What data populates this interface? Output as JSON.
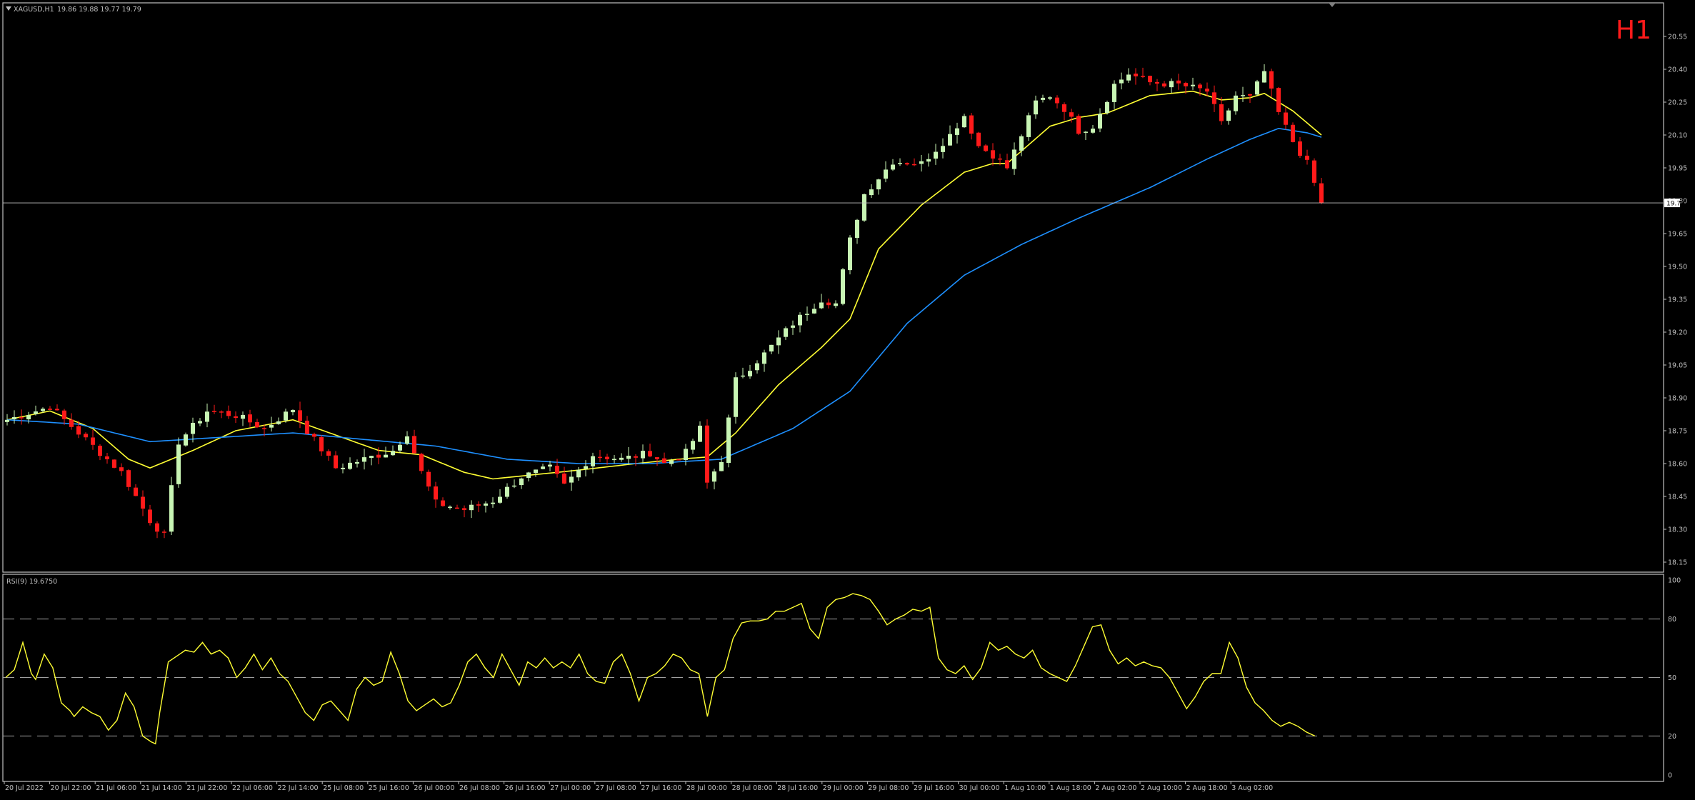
{
  "header": {
    "symbol_label": "XAGUSD,H1",
    "ohlc_label": "19.86 19.88 19.77 19.79",
    "timeframe_badge": "H1"
  },
  "indicator": {
    "label": "RSI(9) 19.6750"
  },
  "colors": {
    "background": "#000000",
    "grid_frame": "#c0c0c0",
    "axis_text": "#c0c0c0",
    "bull_candle": "#c8f5b4",
    "bear_candle": "#ff1a1a",
    "ma_fast": "#ffff33",
    "ma_slow": "#1e90ff",
    "rsi_line": "#ffff33",
    "rsi_level": "#a0a0a0",
    "badge": "#ff1a1a"
  },
  "chart_data": [
    {
      "type": "candlestick",
      "panel": "price",
      "symbol": "XAGUSD",
      "timeframe": "H1",
      "ylim": [
        18.15,
        20.55
      ],
      "y_ticks": [
        20.55,
        20.4,
        20.25,
        20.1,
        19.95,
        19.8,
        19.65,
        19.5,
        19.35,
        19.2,
        19.05,
        18.9,
        18.75,
        18.6,
        18.45,
        18.3,
        18.15
      ],
      "y_tick_labels": [
        "20.55",
        "20.40",
        "20.25",
        "20.10",
        "19.95",
        "19.80",
        "19.65",
        "19.50",
        "19.35",
        "19.20",
        "19.05",
        "18.90",
        "18.75",
        "18.60",
        "18.45",
        "18.30",
        "18.15"
      ],
      "current_price": 19.79,
      "current_price_label": "19.79",
      "x_labels": [
        "20 Jul 2022",
        "20 Jul 22:00",
        "21 Jul 06:00",
        "21 Jul 14:00",
        "21 Jul 22:00",
        "22 Jul 06:00",
        "22 Jul 14:00",
        "25 Jul 08:00",
        "25 Jul 16:00",
        "26 Jul 00:00",
        "26 Jul 08:00",
        "26 Jul 16:00",
        "27 Jul 00:00",
        "27 Jul 08:00",
        "27 Jul 16:00",
        "28 Jul 00:00",
        "28 Jul 08:00",
        "28 Jul 16:00",
        "29 Jul 00:00",
        "29 Jul 08:00",
        "29 Jul 16:00",
        "30 Jul 00:00",
        "1 Aug 10:00",
        "1 Aug 18:00",
        "2 Aug 02:00",
        "2 Aug 10:00",
        "2 Aug 18:00",
        "3 Aug 02:00"
      ],
      "close_anchors": [
        [
          0,
          18.8
        ],
        [
          6,
          18.86
        ],
        [
          10,
          18.74
        ],
        [
          16,
          18.56
        ],
        [
          20,
          18.34
        ],
        [
          22,
          18.27
        ],
        [
          24,
          18.7
        ],
        [
          28,
          18.84
        ],
        [
          32,
          18.82
        ],
        [
          36,
          18.76
        ],
        [
          40,
          18.85
        ],
        [
          42,
          18.75
        ],
        [
          46,
          18.58
        ],
        [
          50,
          18.62
        ],
        [
          54,
          18.66
        ],
        [
          56,
          18.74
        ],
        [
          58,
          18.56
        ],
        [
          60,
          18.42
        ],
        [
          64,
          18.39
        ],
        [
          68,
          18.43
        ],
        [
          72,
          18.54
        ],
        [
          76,
          18.58
        ],
        [
          78,
          18.5
        ],
        [
          82,
          18.64
        ],
        [
          86,
          18.62
        ],
        [
          90,
          18.65
        ],
        [
          92,
          18.6
        ],
        [
          95,
          18.65
        ],
        [
          97,
          18.76
        ],
        [
          98,
          18.51
        ],
        [
          100,
          18.62
        ],
        [
          102,
          18.98
        ],
        [
          106,
          19.1
        ],
        [
          110,
          19.24
        ],
        [
          114,
          19.35
        ],
        [
          116,
          19.33
        ],
        [
          118,
          19.62
        ],
        [
          120,
          19.83
        ],
        [
          124,
          19.98
        ],
        [
          128,
          19.97
        ],
        [
          132,
          20.1
        ],
        [
          134,
          20.19
        ],
        [
          136,
          20.05
        ],
        [
          138,
          20.01
        ],
        [
          140,
          19.95
        ],
        [
          144,
          20.25
        ],
        [
          146,
          20.28
        ],
        [
          148,
          20.22
        ],
        [
          150,
          20.12
        ],
        [
          152,
          20.14
        ],
        [
          155,
          20.33
        ],
        [
          157,
          20.38
        ],
        [
          160,
          20.34
        ],
        [
          164,
          20.33
        ],
        [
          168,
          20.3
        ],
        [
          170,
          20.15
        ],
        [
          172,
          20.28
        ],
        [
          174,
          20.27
        ],
        [
          176,
          20.39
        ],
        [
          178,
          20.2
        ],
        [
          180,
          20.07
        ],
        [
          182,
          19.97
        ],
        [
          184,
          19.79
        ]
      ],
      "moving_averages": [
        {
          "color": "yellow",
          "anchors": [
            [
              0,
              18.8
            ],
            [
              6,
              18.84
            ],
            [
              12,
              18.76
            ],
            [
              17,
              18.62
            ],
            [
              20,
              18.58
            ],
            [
              26,
              18.66
            ],
            [
              32,
              18.75
            ],
            [
              40,
              18.8
            ],
            [
              46,
              18.73
            ],
            [
              52,
              18.66
            ],
            [
              58,
              18.64
            ],
            [
              64,
              18.56
            ],
            [
              68,
              18.53
            ],
            [
              74,
              18.55
            ],
            [
              80,
              18.57
            ],
            [
              88,
              18.6
            ],
            [
              94,
              18.62
            ],
            [
              98,
              18.63
            ],
            [
              102,
              18.74
            ],
            [
              108,
              18.96
            ],
            [
              114,
              19.13
            ],
            [
              118,
              19.26
            ],
            [
              122,
              19.58
            ],
            [
              128,
              19.78
            ],
            [
              134,
              19.93
            ],
            [
              138,
              19.97
            ],
            [
              140,
              19.97
            ],
            [
              146,
              20.14
            ],
            [
              150,
              20.18
            ],
            [
              154,
              20.2
            ],
            [
              160,
              20.28
            ],
            [
              166,
              20.3
            ],
            [
              170,
              20.26
            ],
            [
              174,
              20.27
            ],
            [
              176,
              20.29
            ],
            [
              180,
              20.21
            ],
            [
              184,
              20.1
            ]
          ]
        },
        {
          "color": "blue",
          "anchors": [
            [
              0,
              18.8
            ],
            [
              10,
              18.78
            ],
            [
              20,
              18.7
            ],
            [
              30,
              18.72
            ],
            [
              40,
              18.74
            ],
            [
              50,
              18.71
            ],
            [
              60,
              18.68
            ],
            [
              70,
              18.62
            ],
            [
              80,
              18.6
            ],
            [
              90,
              18.6
            ],
            [
              100,
              18.62
            ],
            [
              110,
              18.76
            ],
            [
              118,
              18.93
            ],
            [
              126,
              19.24
            ],
            [
              134,
              19.46
            ],
            [
              142,
              19.6
            ],
            [
              150,
              19.72
            ],
            [
              160,
              19.86
            ],
            [
              168,
              19.99
            ],
            [
              174,
              20.08
            ],
            [
              178,
              20.13
            ],
            [
              182,
              20.11
            ],
            [
              184,
              20.09
            ]
          ]
        }
      ]
    },
    {
      "type": "line",
      "panel": "indicator",
      "name": "RSI(9) 19.6750",
      "ylim": [
        0,
        100
      ],
      "y_ticks": [
        100,
        80,
        50,
        20,
        0
      ],
      "y_tick_labels": [
        "100",
        "80",
        "50",
        "20",
        "0"
      ],
      "levels": [
        80,
        50,
        20
      ],
      "anchors": [
        [
          0,
          50
        ],
        [
          2,
          54
        ],
        [
          4,
          68
        ],
        [
          6,
          52
        ],
        [
          7,
          49
        ],
        [
          9,
          62
        ],
        [
          11,
          55
        ],
        [
          13,
          37
        ],
        [
          15,
          33
        ],
        [
          16,
          30
        ],
        [
          18,
          35
        ],
        [
          20,
          32
        ],
        [
          22,
          30
        ],
        [
          24,
          23
        ],
        [
          26,
          28
        ],
        [
          28,
          42
        ],
        [
          30,
          35
        ],
        [
          32,
          20
        ],
        [
          34,
          17
        ],
        [
          35,
          16
        ],
        [
          36,
          32
        ],
        [
          38,
          58
        ],
        [
          42,
          64
        ],
        [
          44,
          63
        ],
        [
          46,
          68
        ],
        [
          48,
          62
        ],
        [
          50,
          64
        ],
        [
          52,
          60
        ],
        [
          54,
          50
        ],
        [
          56,
          55
        ],
        [
          58,
          62
        ],
        [
          60,
          54
        ],
        [
          62,
          60
        ],
        [
          64,
          52
        ],
        [
          66,
          48
        ],
        [
          68,
          40
        ],
        [
          70,
          32
        ],
        [
          72,
          28
        ],
        [
          74,
          36
        ],
        [
          76,
          38
        ],
        [
          78,
          33
        ],
        [
          80,
          28
        ],
        [
          82,
          44
        ],
        [
          84,
          50
        ],
        [
          86,
          46
        ],
        [
          88,
          48
        ],
        [
          90,
          63
        ],
        [
          92,
          52
        ],
        [
          94,
          38
        ],
        [
          96,
          33
        ],
        [
          98,
          36
        ],
        [
          100,
          39
        ],
        [
          102,
          35
        ],
        [
          104,
          37
        ],
        [
          106,
          46
        ],
        [
          108,
          58
        ],
        [
          110,
          62
        ],
        [
          112,
          55
        ],
        [
          114,
          50
        ],
        [
          116,
          62
        ],
        [
          118,
          54
        ],
        [
          120,
          46
        ],
        [
          122,
          58
        ],
        [
          124,
          55
        ],
        [
          126,
          60
        ],
        [
          128,
          55
        ],
        [
          130,
          58
        ],
        [
          132,
          55
        ],
        [
          134,
          62
        ],
        [
          136,
          52
        ],
        [
          138,
          48
        ],
        [
          140,
          47
        ],
        [
          142,
          58
        ],
        [
          144,
          62
        ],
        [
          146,
          52
        ],
        [
          148,
          38
        ],
        [
          150,
          50
        ],
        [
          152,
          52
        ],
        [
          154,
          56
        ],
        [
          156,
          62
        ],
        [
          158,
          60
        ],
        [
          160,
          54
        ],
        [
          162,
          52
        ],
        [
          164,
          30
        ],
        [
          166,
          50
        ],
        [
          168,
          54
        ],
        [
          170,
          70
        ],
        [
          172,
          78
        ],
        [
          174,
          79
        ],
        [
          176,
          79
        ],
        [
          178,
          80
        ],
        [
          180,
          84
        ],
        [
          182,
          84
        ],
        [
          184,
          86
        ],
        [
          186,
          88
        ],
        [
          188,
          75
        ],
        [
          190,
          70
        ],
        [
          192,
          86
        ],
        [
          194,
          90
        ],
        [
          196,
          91
        ],
        [
          198,
          93
        ],
        [
          200,
          92
        ],
        [
          202,
          90
        ],
        [
          204,
          84
        ],
        [
          206,
          77
        ],
        [
          208,
          80
        ],
        [
          210,
          82
        ],
        [
          212,
          85
        ],
        [
          214,
          84
        ],
        [
          216,
          86
        ],
        [
          218,
          60
        ],
        [
          220,
          54
        ],
        [
          222,
          52
        ],
        [
          224,
          56
        ],
        [
          226,
          49
        ],
        [
          228,
          55
        ],
        [
          230,
          68
        ],
        [
          232,
          64
        ],
        [
          234,
          66
        ],
        [
          236,
          62
        ],
        [
          238,
          60
        ],
        [
          240,
          64
        ],
        [
          242,
          55
        ],
        [
          244,
          52
        ],
        [
          246,
          50
        ],
        [
          248,
          48
        ],
        [
          250,
          56
        ],
        [
          252,
          66
        ],
        [
          254,
          76
        ],
        [
          256,
          77
        ],
        [
          258,
          64
        ],
        [
          260,
          57
        ],
        [
          262,
          60
        ],
        [
          264,
          56
        ],
        [
          266,
          58
        ],
        [
          268,
          56
        ],
        [
          270,
          55
        ],
        [
          272,
          50
        ],
        [
          274,
          42
        ],
        [
          276,
          34
        ],
        [
          278,
          40
        ],
        [
          280,
          48
        ],
        [
          282,
          52
        ],
        [
          284,
          52
        ],
        [
          286,
          68
        ],
        [
          288,
          60
        ],
        [
          290,
          45
        ],
        [
          292,
          37
        ],
        [
          294,
          33
        ],
        [
          296,
          28
        ],
        [
          298,
          25
        ],
        [
          300,
          27
        ],
        [
          302,
          25
        ],
        [
          304,
          22
        ],
        [
          306,
          20
        ]
      ]
    }
  ]
}
